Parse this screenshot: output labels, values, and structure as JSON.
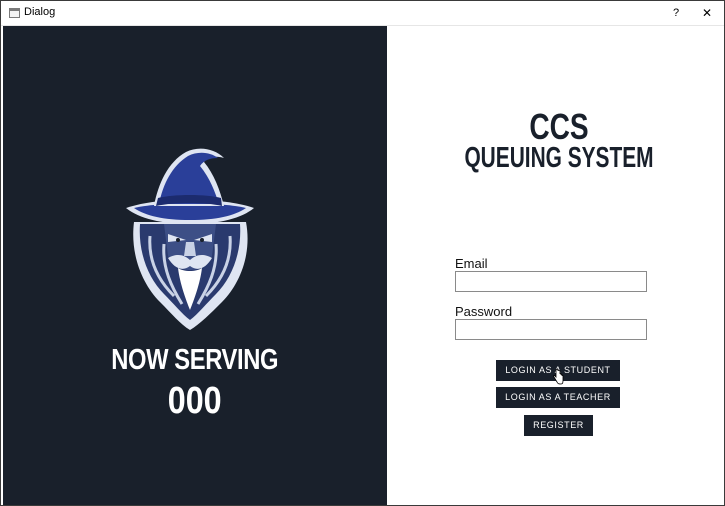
{
  "window": {
    "title": "Dialog",
    "help_label": "?",
    "close_label": "✕"
  },
  "left_panel": {
    "mascot_icon": "wizard-icon",
    "now_serving_label": "NOW SERVING",
    "queue_number": "000"
  },
  "right_panel": {
    "title_line1": "CCS",
    "title_line2": "QUEUING SYSTEM",
    "email": {
      "label": "Email",
      "value": ""
    },
    "password": {
      "label": "Password",
      "value": ""
    },
    "buttons": {
      "student_login": "LOGIN AS A STUDENT",
      "teacher_login": "LOGIN AS A TEACHER",
      "register": "REGISTER"
    }
  },
  "colors": {
    "panel_dark": "#19202b",
    "hat_blue": "#2a3f99",
    "button_bg": "#19202b",
    "button_text": "#ffffff"
  }
}
